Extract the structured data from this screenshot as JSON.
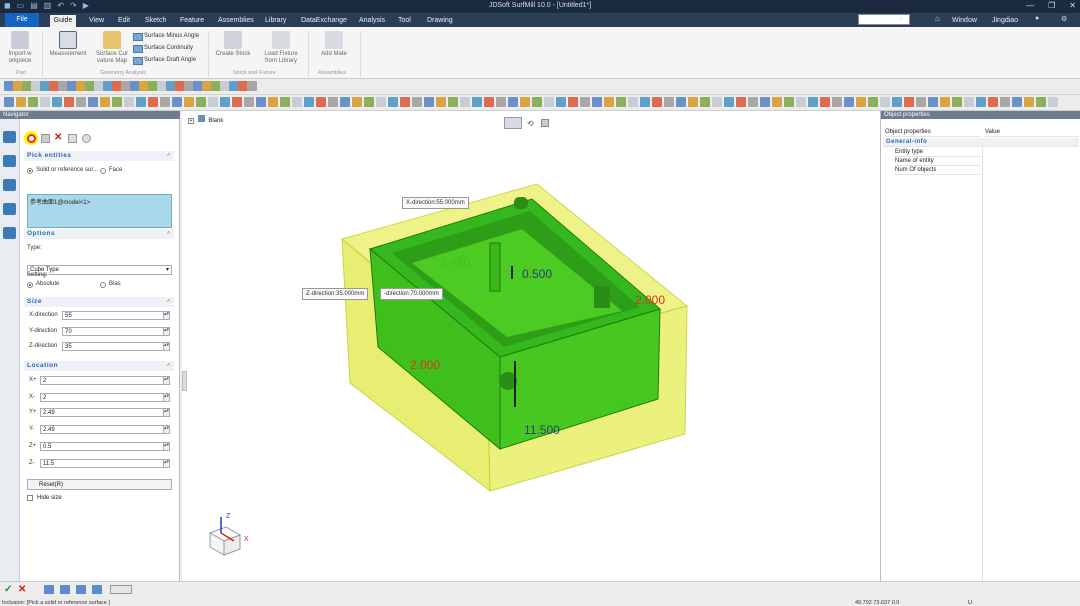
{
  "titlebar": {
    "title": "JDSoft SurfMill 10.0 - [Untitled1*]",
    "window_controls": [
      "—",
      "❐",
      "✕"
    ]
  },
  "menu": {
    "file": "File",
    "tabs": [
      "Guide",
      "View",
      "Edit",
      "Sketch",
      "Feature",
      "Assemblies",
      "Library",
      "DataExchange",
      "Analysis",
      "Tool",
      "Drawing"
    ],
    "active": "Guide",
    "right": {
      "window": "Window",
      "user": "Jingdiao"
    }
  },
  "ribbon": {
    "import": "Import w orkpiece",
    "measurement": "Measurement",
    "curvature": "Surface Cur vature Map",
    "minus_angle": "Surface Minus Angle",
    "continuity": "Surface Continuity",
    "draft": "Surface Draft Angle",
    "create_stock": "Create Stock",
    "load_fixture": "Load Fixture from Library",
    "add_mate": "Add Mate",
    "groups": {
      "part": "Part",
      "geometry": "Geometry Analysis",
      "stock": "Stock and Fixture",
      "assemblies": "Assemblies"
    }
  },
  "navigator": {
    "title": "Navigator",
    "pick": {
      "header": "Pick entities",
      "opt1": "Solid or reference sur...",
      "opt2": "Face",
      "list_item": "参考曲面1@model<1>"
    },
    "options": {
      "header": "Options",
      "type_label": "Type:",
      "type_value": "Cube Type",
      "setting_label": "Setting:",
      "absolute": "Absolute",
      "bias": "Bias"
    },
    "size": {
      "header": "Size",
      "fields": [
        {
          "label": "X-direction",
          "value": "55"
        },
        {
          "label": "Y-direction",
          "value": "70"
        },
        {
          "label": "Z-direction",
          "value": "35"
        }
      ]
    },
    "location": {
      "header": "Location",
      "fields": [
        {
          "label": "X+",
          "value": "2"
        },
        {
          "label": "X-",
          "value": "2"
        },
        {
          "label": "Y+",
          "value": "2.49"
        },
        {
          "label": "Y-",
          "value": "2.49"
        },
        {
          "label": "Z+",
          "value": "0.5"
        },
        {
          "label": "Z-",
          "value": "11.5"
        }
      ]
    },
    "reset": "Reset(R)",
    "hide_size": "Hide size"
  },
  "viewport": {
    "tree_label": "Blank",
    "tooltips": {
      "x": "X-direction:55.000mm",
      "z": "Z-direction:35.000mm",
      "y": "-direction:70.000mm"
    },
    "dims": {
      "top": "0.500",
      "left": "2.000",
      "right": "2.000",
      "bottom": "11.500",
      "front": "2.490",
      "back": "2.490"
    },
    "axes": {
      "z": "Z",
      "x": "X"
    }
  },
  "properties": {
    "title": "Object properties",
    "col1": "Object properties",
    "col2": "Value",
    "group": "General-info",
    "rows": [
      "Entity type",
      "Name of entity",
      "Num Of objects"
    ]
  },
  "status": {
    "text": "Inclusion: [Pick a solid or reference surface ]",
    "coords": "49.792 73.637 0.0",
    "unit": "U"
  },
  "colors": {
    "titlebar": "#1b2a3f",
    "menubar": "#2b3e58",
    "accent": "#1565c0",
    "part_green": "#3ec21b",
    "stock_yellow": "#e6f05a",
    "dim_red": "#e0341a",
    "highlight": "#ffef00"
  }
}
